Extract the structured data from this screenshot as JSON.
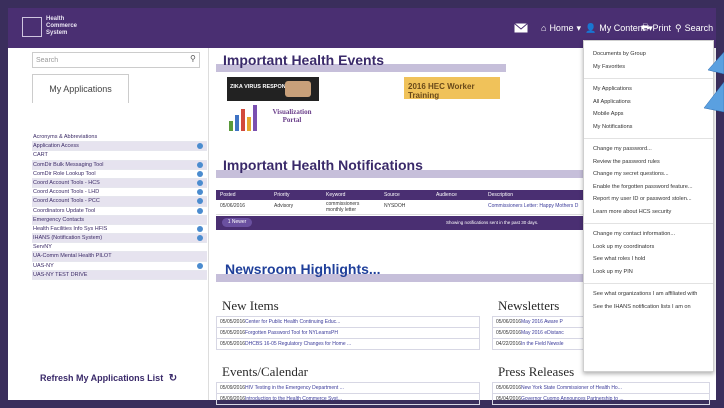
{
  "logo": {
    "lines": [
      "Health",
      "Commerce",
      "System"
    ]
  },
  "nav": {
    "home": "Home",
    "my_content": "My Content",
    "print": "Print",
    "search": "Search"
  },
  "sidebar": {
    "search_placeholder": "Search",
    "tab": "My Applications",
    "items": [
      "Acronyms & Abbreviations",
      "Application Access",
      "CART",
      "ComDir Bulk Messaging Tool",
      "ComDir Role Lookup Tool",
      "Coord Account Tools - HCS",
      "Coord Account Tools - LHD",
      "Coord Account Tools - PCC",
      "Coordinators Update Tool",
      "Emergency Contacts",
      "Health Facilities Info Sys HFIS",
      "IHANS (Notification System)",
      "ServNY",
      "UA-Comm Mental Health PILOT",
      "UAS-NY",
      "UAS-NY TEST DRIVE"
    ],
    "refresh": "Refresh My Applications List"
  },
  "main": {
    "events_title": "Important Health Events",
    "zika": "ZIKA VIRUS RESPONSE",
    "viz": [
      "Visualization",
      "Portal"
    ],
    "hec": "2016 HEC Worker Training",
    "notif_title": "Important Health Notifications",
    "notif_headers": [
      "Posted",
      "Priority",
      "Keyword",
      "Source",
      "Audience",
      "Description"
    ],
    "notif_row": {
      "posted": "05/06/2016",
      "priority": "Advisory",
      "keyword": "commissioners monthly letter",
      "source": "NYSDOH",
      "description": "Commissioners Letter: Happy Mothers D"
    },
    "notif_filter": "1 Newer",
    "notif_footer": "Showing notifications sent in the past 30 days.",
    "newsroom": "Newsroom Highlights...",
    "new_items_title": "New Items",
    "new_items": [
      {
        "date": "05/05/2016",
        "text": "Center for Public Health Continuing Educ..."
      },
      {
        "date": "05/05/2016",
        "text": "Forgotten Password Tool for NYLearnsPH"
      },
      {
        "date": "05/05/2016",
        "text": "DHCBS 16-05 Regulatory Changes for Home ..."
      }
    ],
    "newsletters_title": "Newsletters",
    "newsletters": [
      {
        "date": "05/06/2016",
        "text": "May 2016 Aware P"
      },
      {
        "date": "05/05/2016",
        "text": "May 2016 eDistanc"
      },
      {
        "date": "04/22/2016",
        "text": "In the Field Newsle"
      }
    ],
    "events_cal_title": "Events/Calendar",
    "events_cal": [
      {
        "date": "05/09/2016",
        "text": "HIV Testing in the Emergency Department ..."
      },
      {
        "date": "05/09/2016",
        "text": "Introduction to the Health Commerce Syst..."
      }
    ],
    "press_title": "Press Releases",
    "press": [
      {
        "date": "05/06/2016",
        "text": "New York State Commissioner of Health Ho..."
      },
      {
        "date": "05/04/2016",
        "text": "Governor Cuomo Announces Partnership to ..."
      }
    ]
  },
  "dropdown": {
    "groups": [
      [
        "Documents by Group",
        "My Favorites"
      ],
      [
        "My Applications",
        "All Applications",
        "Mobile Apps",
        "My Notifications"
      ],
      [
        "Change my password...",
        "Review the password rules",
        "Change my secret questions...",
        "Enable the forgotten password feature...",
        "Report my user ID or password stolen...",
        "Learn more about HCS security"
      ],
      [
        "Change my contact information...",
        "Look up my coordinators",
        "See what roles I hold",
        "Look up my PIN"
      ],
      [
        "See what organizations I am affiliated with",
        "See the IHANS notification lists I am on"
      ]
    ]
  },
  "colors": {
    "brand": "#4a2f72",
    "band": "#c6bfda",
    "link": "#3b2a66",
    "accent": "#f0c25a"
  }
}
